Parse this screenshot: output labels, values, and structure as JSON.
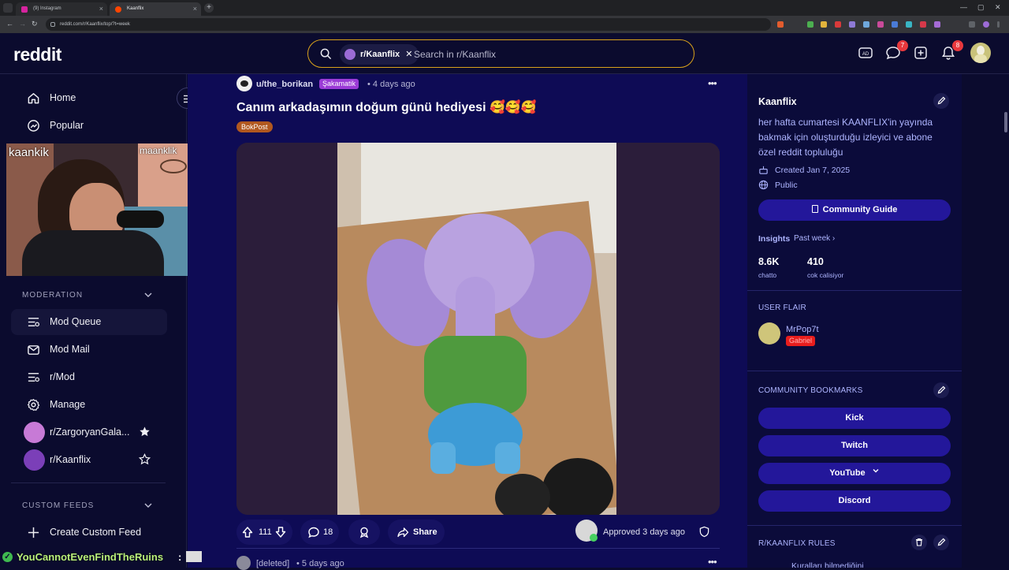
{
  "browser": {
    "tabs": [
      {
        "label": "(9) Instagram",
        "active": false
      },
      {
        "label": "Kaanflix",
        "active": true
      }
    ],
    "url": "reddit.com/r/Kaanflix/top/?t=week"
  },
  "header": {
    "logo": "reddit",
    "search_chip": "r/Kaanflix",
    "search_placeholder": "Search in r/Kaanflix",
    "chat_badge": "7",
    "notif_badge": "8"
  },
  "sidebar": {
    "items": [
      {
        "label": "Home",
        "icon": "home-icon"
      },
      {
        "label": "Popular",
        "icon": "popular-icon"
      }
    ],
    "moderation_header": "MODERATION",
    "mod_items": [
      {
        "label": "Mod Queue",
        "icon": "queue-icon"
      },
      {
        "label": "Mod Mail",
        "icon": "mail-icon"
      },
      {
        "label": "r/Mod",
        "icon": "queue-icon"
      },
      {
        "label": "Manage",
        "icon": "gear-icon"
      },
      {
        "label": "r/ZargoryanGala...",
        "icon": "community-avatar"
      },
      {
        "label": "r/Kaanflix",
        "icon": "community-avatar"
      }
    ],
    "custom_feeds_header": "CUSTOM FEEDS",
    "create_feed": "Create Custom Feed"
  },
  "webcam": {
    "label_left": "kaankik",
    "label_right": "maanklik"
  },
  "post": {
    "author": "u/the_borikan",
    "author_flair": "Şakamatik",
    "time": "• 4 days ago",
    "title": "Canım arkadaşımın doğum günü hediyesi 🥰🥰🥰",
    "post_flair": "BokPost",
    "votes": "111",
    "comments": "18",
    "share": "Share",
    "status": "Approved 3 days ago"
  },
  "next_post": {
    "author": "[deleted]",
    "time": "• 5 days ago"
  },
  "community": {
    "name": "Kaanflix",
    "description": "her hafta cumartesi KAANFLIX'in yayında bakmak için oluşturduğu izleyici ve abone özel reddit topluluğu",
    "created": "Created Jan 7, 2025",
    "visibility": "Public",
    "guide_button": "Community Guide",
    "insights_label": "Insights",
    "insights_range": "Past week",
    "stat1_value": "8.6K",
    "stat1_label": "chatto",
    "stat2_value": "410",
    "stat2_label": "cok calisiyor",
    "user_flair_header": "USER FLAIR",
    "user_flair_name": "MrPop7t",
    "user_flair_tag": "Gabriel",
    "bookmarks_header": "COMMUNITY BOOKMARKS",
    "bookmarks": [
      "Kick",
      "Twitch",
      "YouTube",
      "Discord"
    ],
    "rules_header": "R/KAANFLIX RULES",
    "rules_peek": "Kuralları bilmediğini"
  },
  "chat_overlay": {
    "username": "YouCannotEvenFindTheRuins",
    "colon": ":"
  },
  "colors": {
    "accent_search_border": "#d9a21b",
    "feed_bg": "#0e0b55",
    "pill_bg": "#23179a",
    "flair_purple": "#9b3bd6",
    "flair_orange": "#b1581f"
  }
}
